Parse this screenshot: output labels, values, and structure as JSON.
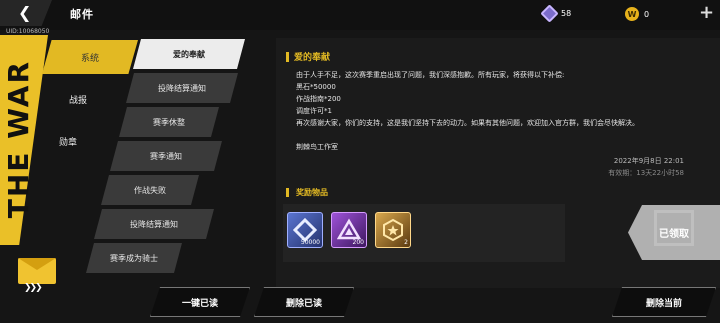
{
  "header": {
    "back_icon": "back-arrow-icon",
    "title": "邮件",
    "uid": "UID:10068050",
    "gems": "58",
    "coins": "0",
    "coin_letter": "W",
    "add_icon": "plus-icon"
  },
  "decor": {
    "war_text": "THE WAR"
  },
  "categories": [
    {
      "label": "系统",
      "active": true
    },
    {
      "label": "战报",
      "active": false
    },
    {
      "label": "勋章",
      "active": false
    }
  ],
  "mails": [
    {
      "label": "爱的奉献",
      "active": true
    },
    {
      "label": "投降结算通知",
      "active": false
    },
    {
      "label": "赛季休整",
      "active": false
    },
    {
      "label": "赛季通知",
      "active": false
    },
    {
      "label": "作战失败",
      "active": false
    },
    {
      "label": "投降结算通知",
      "active": false
    },
    {
      "label": "赛季成为骑士",
      "active": false
    }
  ],
  "detail": {
    "title": "爱的奉献",
    "lines": [
      "由于人手不足，这次赛季重启出现了问题，我们深感抱歉。所有玩家，将获得以下补偿:",
      "黑石*50000",
      "作战指南*200",
      "调度许可*1",
      "再次感谢大家，你们的支持，这是我们坚持下去的动力。如果有其他问题，欢迎加入官方群，我们会尽快解决。",
      "",
      "荆棘鸟工作室"
    ],
    "date": "2022年9月8日  22:01",
    "validity": "有效期：13天22小时58",
    "rewards_title": "奖励物品",
    "rewards": [
      {
        "name": "blue-diamond-icon",
        "qty": "50000"
      },
      {
        "name": "purple-triangle-icon",
        "qty": "200"
      },
      {
        "name": "gold-badge-icon",
        "qty": "2"
      }
    ],
    "claimed_label": "已领取"
  },
  "actions": {
    "read_all": "一键已读",
    "delete_read": "删除已读",
    "delete_current": "删除当前"
  },
  "colors": {
    "accent": "#e2b923",
    "background": "#151515"
  }
}
